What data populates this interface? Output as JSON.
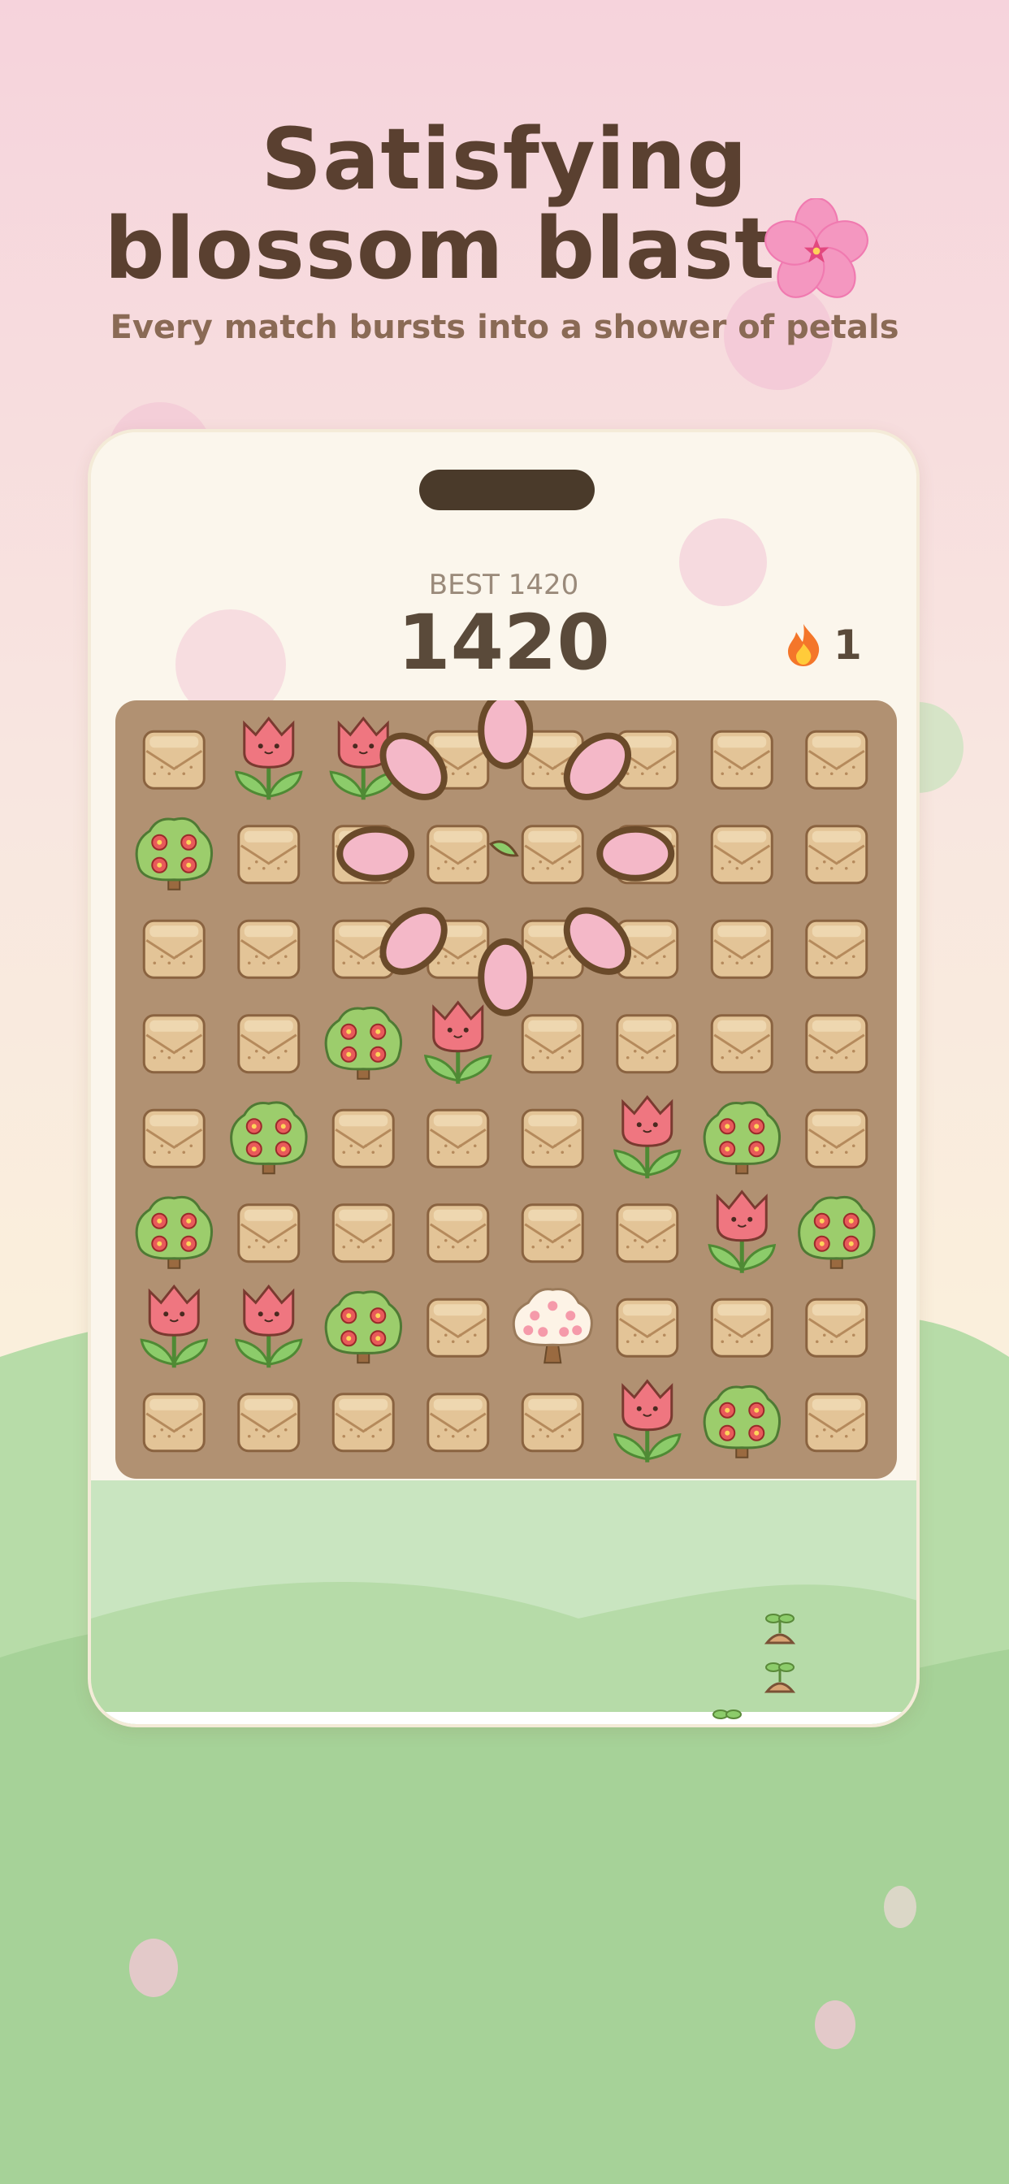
{
  "headline": {
    "line1": "Satisfying",
    "line2": "blossom blasts",
    "subtitle": "Every match bursts into a shower of petals"
  },
  "game": {
    "best_label": "BEST 1420",
    "score": "1420",
    "streak_count": "1",
    "streak_icon": "fire-icon",
    "board": {
      "rows": 8,
      "cols": 8,
      "cells": [
        [
          "block",
          "tulip",
          "tulip",
          "block",
          "block",
          "block",
          "block",
          "block"
        ],
        [
          "bush",
          "block",
          "block",
          "block",
          "block",
          "block",
          "block",
          "block"
        ],
        [
          "block",
          "block",
          "block",
          "block",
          "block",
          "block",
          "block",
          "block"
        ],
        [
          "block",
          "block",
          "bush",
          "tulip",
          "block",
          "block",
          "block",
          "block"
        ],
        [
          "block",
          "bush",
          "block",
          "block",
          "block",
          "tulip",
          "bush",
          "block"
        ],
        [
          "bush",
          "block",
          "block",
          "block",
          "block",
          "block",
          "tulip",
          "bush"
        ],
        [
          "tulip",
          "tulip",
          "bush",
          "block",
          "blossom-tree",
          "block",
          "block",
          "block"
        ],
        [
          "block",
          "block",
          "block",
          "block",
          "block",
          "tulip",
          "bush",
          "block"
        ]
      ],
      "burst_effect": "petal-burst"
    }
  },
  "colors": {
    "sky_top": "#f6d5dc",
    "sky_bottom": "#f9ecd9",
    "hill": "#a6d298",
    "headline": "#5a4030",
    "subtitle": "#8a6a55",
    "board": "#b19172",
    "petal": "#f4b8c8",
    "tulip": "#ef7680",
    "bush": "#9ccd6c",
    "block": "#e3c497"
  }
}
